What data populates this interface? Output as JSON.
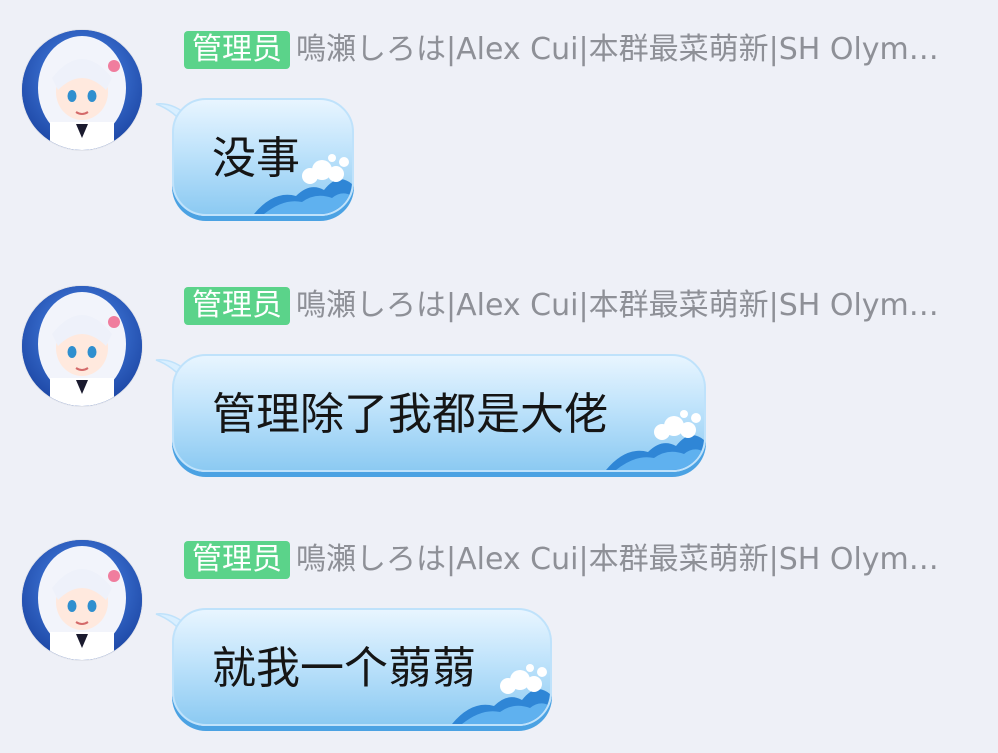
{
  "chat": {
    "messages": [
      {
        "badge": "管理员",
        "sender": "鳴瀬しろは|Alex Cui|本群最菜萌新|SH Olympus|...",
        "text": "没事"
      },
      {
        "badge": "管理员",
        "sender": "鳴瀬しろは|Alex Cui|本群最菜萌新|SH Olympus|...",
        "text": "管理除了我都是大佬"
      },
      {
        "badge": "管理员",
        "sender": "鳴瀬しろは|Alex Cui|本群最菜萌新|SH Olympus|...",
        "text": "就我一个蒻蒻"
      }
    ]
  },
  "colors": {
    "background": "#eef0f7",
    "badge": "#5bd38a",
    "nickname": "#8e9097",
    "bubble_top": "#e8f5ff",
    "bubble_bottom": "#8ccaf2",
    "bubble_border": "#4ba2e3"
  },
  "icons": {
    "avatar": "anime-avatar-icon",
    "bubble_decoration": "wave-icon"
  }
}
